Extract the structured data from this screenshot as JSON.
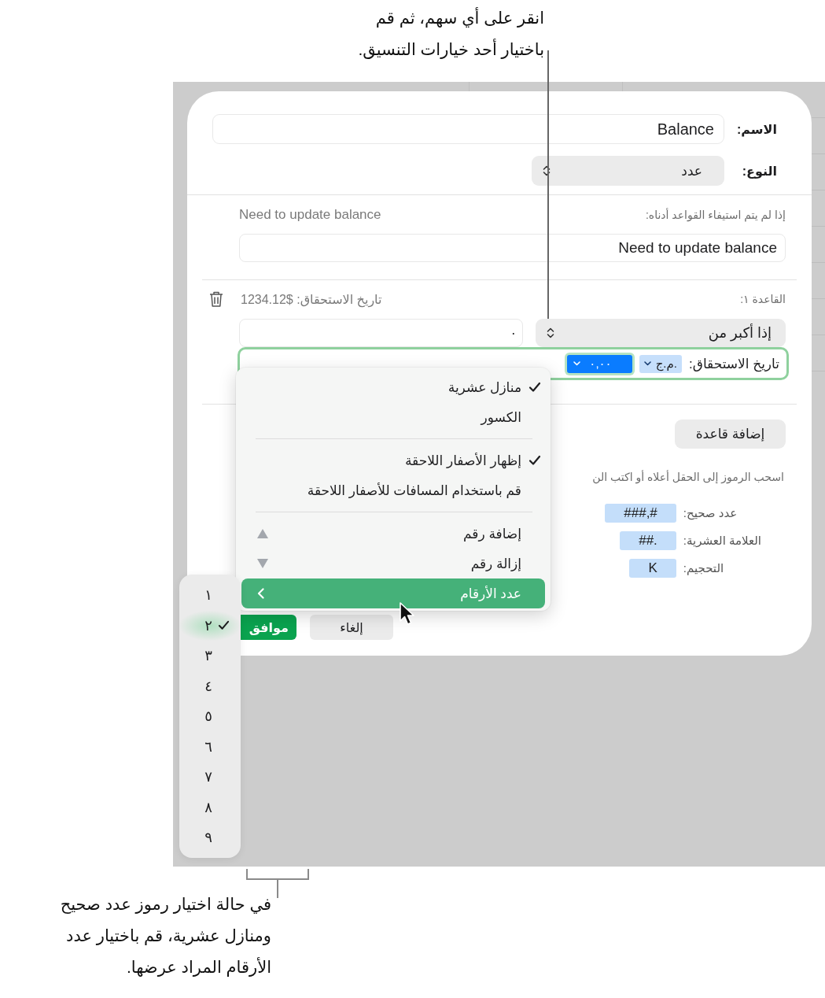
{
  "top_callout": {
    "lines": [
      "انقر على أي سهم، ثم قم",
      "باختيار أحد خيارات التنسيق."
    ]
  },
  "dialog": {
    "name": {
      "label": "الاسم:",
      "value": "Balance"
    },
    "type": {
      "label": "النوع:",
      "value": "عدد"
    },
    "fallback": {
      "label": "إذا لم يتم استيفاء القواعد أدناه:",
      "preview": "Need to update balance",
      "value": "Need to update balance"
    },
    "rules": [
      {
        "title": "القاعدة ١:",
        "preview": "تاريخ الاستحقاق: $1234.12",
        "condition": "إذا أكبر من",
        "operand": "٠",
        "format": {
          "focused": true,
          "label": "تاريخ الاستحقاق:",
          "tokens": [
            {
              "text": "ج.م.",
              "selected": false
            },
            {
              "text": "٠,٠٠",
              "selected": true
            }
          ]
        }
      }
    ],
    "add_rule": "إضافة قاعدة",
    "hint": "اسحب الرموز إلى الحقل أعلاه أو اكتب الن",
    "symbols": [
      {
        "label": "عدد صحيح:",
        "token": "###,#"
      },
      {
        "label": "العلامة العشرية:",
        "token": "##."
      },
      {
        "label": "التحجيم:",
        "token": "K"
      }
    ],
    "buttons": [
      {
        "label": "إلغاء",
        "kind": "secondary"
      },
      {
        "label": "موافق",
        "kind": "primary"
      }
    ]
  },
  "format_menu": {
    "items": [
      {
        "kind": "option",
        "label": "منازل عشرية",
        "checked": true,
        "selected": false
      },
      {
        "kind": "option",
        "label": "الكسور",
        "checked": false,
        "selected": false
      },
      {
        "kind": "separator"
      },
      {
        "kind": "option",
        "label": "إظهار الأصفار اللاحقة",
        "checked": true,
        "selected": false
      },
      {
        "kind": "option",
        "label": "قم باستخدام المسافات للأصفار اللاحقة",
        "checked": false,
        "selected": false
      },
      {
        "kind": "separator"
      },
      {
        "kind": "increase",
        "label": "إضافة رقم",
        "checked": false,
        "selected": false
      },
      {
        "kind": "decrease",
        "label": "إزالة رقم",
        "checked": false,
        "selected": false
      },
      {
        "kind": "submenu",
        "label": "عدد الأرقام",
        "checked": false,
        "selected": true
      }
    ]
  },
  "digits_menu": {
    "items": [
      {
        "label": "١",
        "selected": false
      },
      {
        "label": "٢",
        "selected": true
      },
      {
        "label": "٣",
        "selected": false
      },
      {
        "label": "٤",
        "selected": false
      },
      {
        "label": "٥",
        "selected": false
      },
      {
        "label": "٦",
        "selected": false
      },
      {
        "label": "٧",
        "selected": false
      },
      {
        "label": "٨",
        "selected": false
      },
      {
        "label": "٩",
        "selected": false
      }
    ]
  },
  "bottom_callout": {
    "lines": [
      "في حالة اختيار رموز عدد صحيح",
      "ومنازل عشرية، قم باختيار عدد",
      "الأرقام المراد عرضها."
    ]
  }
}
